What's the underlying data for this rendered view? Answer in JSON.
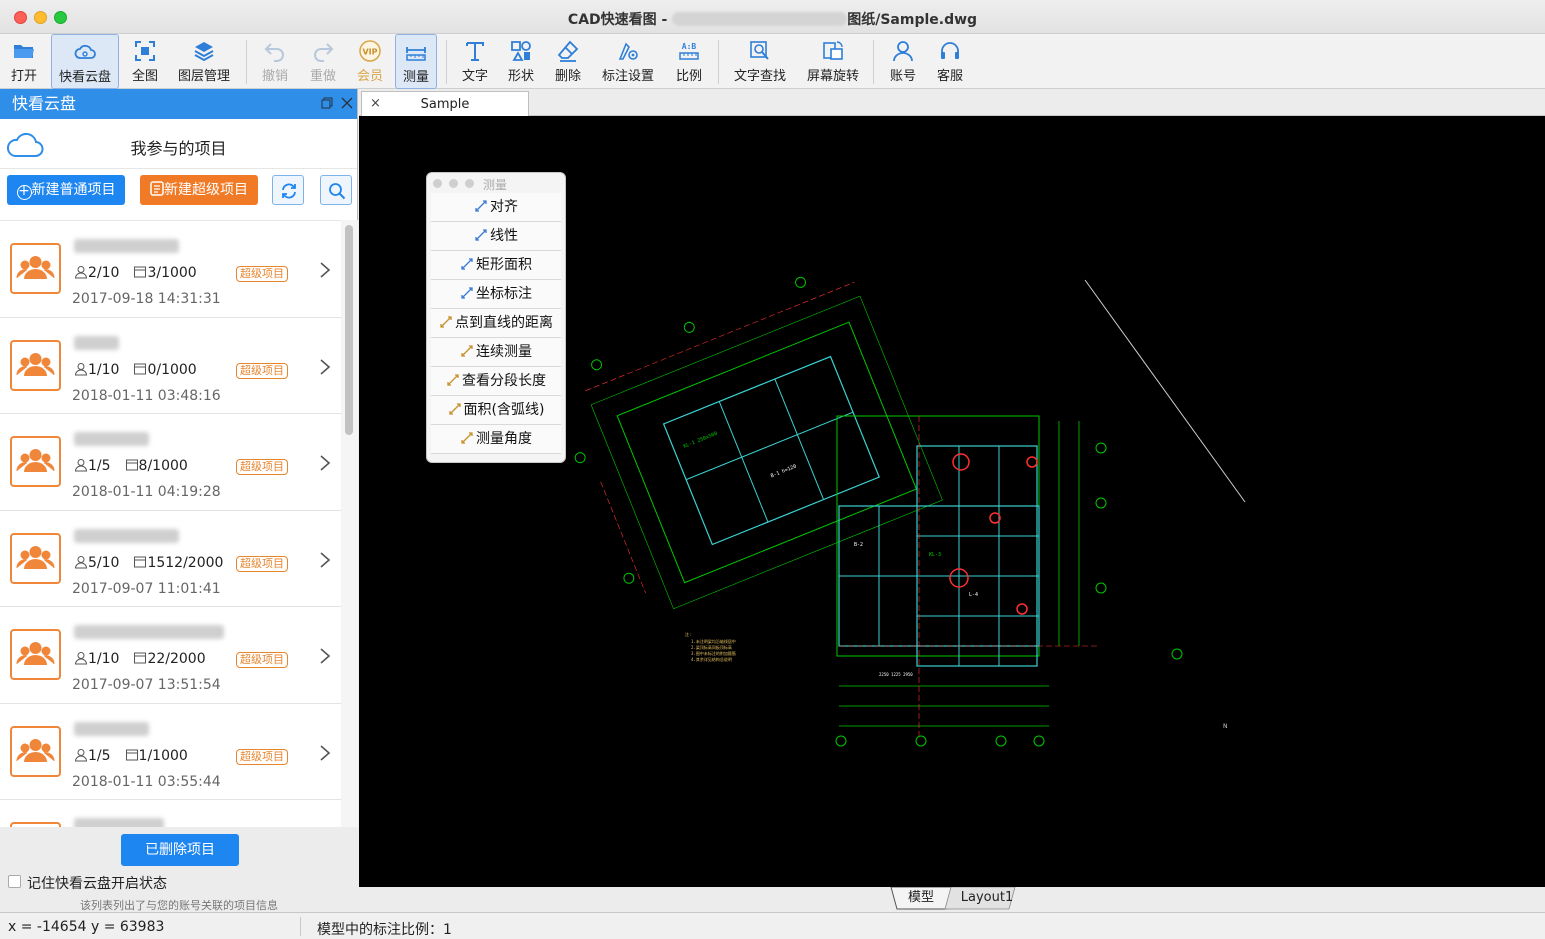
{
  "window": {
    "title_prefix": "CAD快速看图 - ",
    "title_suffix": "图纸/Sample.dwg"
  },
  "toolbar": {
    "open": "打开",
    "cloud": "快看云盘",
    "fullview": "全图",
    "layers": "图层管理",
    "undo": "撤销",
    "redo": "重做",
    "vip": "会员",
    "measure": "测量",
    "text": "文字",
    "shape": "形状",
    "delete": "删除",
    "annotation_settings": "标注设置",
    "scale": "比例",
    "text_search": "文字查找",
    "rotate_screen": "屏幕旋转",
    "account": "账号",
    "support": "客服"
  },
  "panel": {
    "title": "快看云盘",
    "heading": "我参与的项目",
    "new_normal": "新建普通项目",
    "new_super": "新建超级项目",
    "deleted_projects": "已删除项目",
    "remember_state": "记住快看云盘开启状态",
    "hint": "该列表列出了与您的账号关联的项目信息",
    "projects": [
      {
        "members": "2/10",
        "files": "3/1000",
        "badge": "超级项目",
        "date": "2017-09-18 14:31:31"
      },
      {
        "members": "1/10",
        "files": "0/1000",
        "badge": "超级项目",
        "date": "2018-01-11 03:48:16"
      },
      {
        "members": "1/5",
        "files": "8/1000",
        "badge": "超级项目",
        "date": "2018-01-11 04:19:28"
      },
      {
        "members": "5/10",
        "files": "1512/2000",
        "badge": "超级项目",
        "date": "2017-09-07 11:01:41"
      },
      {
        "members": "1/10",
        "files": "22/2000",
        "badge": "超级项目",
        "date": "2017-09-07 13:51:54"
      },
      {
        "members": "1/5",
        "files": "1/1000",
        "badge": "超级项目",
        "date": "2018-01-11 03:55:44"
      }
    ]
  },
  "tabs": {
    "doc_close": "×",
    "doc_name": "Sample",
    "model": "模型",
    "layout1": "Layout1"
  },
  "measure_palette": {
    "title": "测量",
    "items": [
      "对齐",
      "线性",
      "矩形面积",
      "坐标标注",
      "点到直线的距离",
      "连续测量",
      "查看分段长度",
      "面积(含弧线)",
      "测量角度"
    ]
  },
  "status": {
    "coords": "x = -14654 y = 63983",
    "scale": "模型中的标注比例：1"
  },
  "colors": {
    "accent": "#2f8ee8",
    "orange": "#f07a26",
    "cad_green": "#00c800",
    "cad_red": "#ff3030",
    "cad_cyan": "#3ad2d2"
  }
}
